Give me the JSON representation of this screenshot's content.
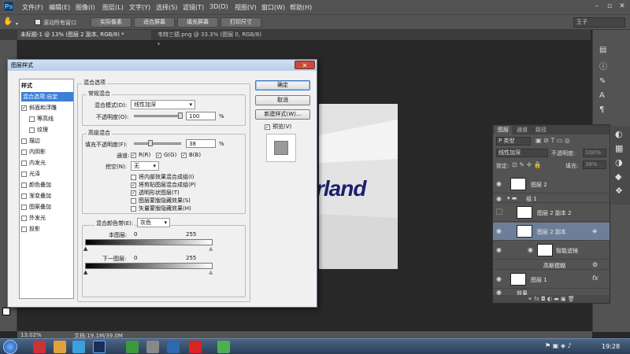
{
  "menubar": {
    "app_icon": "Ps",
    "items": [
      "文件(F)",
      "编辑(E)",
      "图像(I)",
      "图层(L)",
      "文字(Y)",
      "选择(S)",
      "滤镜(T)",
      "3D(D)",
      "视图(V)",
      "窗口(W)",
      "帮助(H)"
    ]
  },
  "optbar": {
    "checkbox_label": "滚动所有窗口",
    "buttons": [
      "实际像素",
      "适合屏幕",
      "填充屏幕",
      "打印尺寸"
    ],
    "workspace": "王子"
  },
  "tabs": [
    "未标题-1 @ 13% (图层 2 副本, RGB/8) *",
    "韦特三德.png @ 33.3% (图层 0, RGB/8) *"
  ],
  "canvas": {
    "text": "rland"
  },
  "dialog": {
    "title": "图层样式",
    "styles_header": "样式",
    "styles": [
      {
        "label": "混合选项:自定",
        "checked": null,
        "selected": true
      },
      {
        "label": "斜面和浮雕",
        "checked": true
      },
      {
        "label": "等高线",
        "checked": false,
        "indent": true
      },
      {
        "label": "纹理",
        "checked": false,
        "indent": true
      },
      {
        "label": "描边",
        "checked": false
      },
      {
        "label": "内阴影",
        "checked": false
      },
      {
        "label": "内发光",
        "checked": false
      },
      {
        "label": "光泽",
        "checked": false
      },
      {
        "label": "颜色叠加",
        "checked": false
      },
      {
        "label": "渐变叠加",
        "checked": false
      },
      {
        "label": "图案叠加",
        "checked": false
      },
      {
        "label": "外发光",
        "checked": false
      },
      {
        "label": "投影",
        "checked": false
      }
    ],
    "blend_options_title": "混合选项",
    "general_title": "常规混合",
    "blend_mode_label": "混合模式(D):",
    "blend_mode_value": "线性加深",
    "opacity_label": "不透明度(O):",
    "opacity_value": "100",
    "percent": "%",
    "advanced_title": "高级混合",
    "fill_opacity_label": "填充不透明度(F):",
    "fill_opacity_value": "38",
    "channels_label": "通道:",
    "channels": [
      "R(R)",
      "G(G)",
      "B(B)"
    ],
    "knockout_label": "挖空(N):",
    "knockout_value": "无",
    "adv_options": [
      {
        "label": "将内部效果混合成组(I)",
        "checked": false
      },
      {
        "label": "将剪贴图层混合成组(P)",
        "checked": true
      },
      {
        "label": "透明形状图层(T)",
        "checked": true
      },
      {
        "label": "图层蒙版隐藏效果(S)",
        "checked": false
      },
      {
        "label": "矢量蒙版隐藏效果(H)",
        "checked": false
      }
    ],
    "blend_if_label": "混合颜色带(E):",
    "blend_if_value": "灰色",
    "this_layer_label": "本图层:",
    "underlying_label": "下一图层:",
    "range_min": "0",
    "range_max": "255",
    "btn_ok": "确定",
    "btn_cancel": "取消",
    "btn_new_style": "新建样式(W)...",
    "preview_label": "预览(V)",
    "close": "✕"
  },
  "layers_panel": {
    "tabs": [
      "图层",
      "通道",
      "路径"
    ],
    "kind": "P 类型",
    "blend_mode": "线性加深",
    "opacity_label": "不透明度:",
    "opacity_value": "100%",
    "lock_label": "锁定:",
    "fill_label": "填充:",
    "fill_value": "38%",
    "layers": [
      {
        "name": "图层 2",
        "indent": 0,
        "eye": true
      },
      {
        "name": "组 1",
        "indent": 0,
        "eye": true,
        "group": true
      },
      {
        "name": "图层 2 副本 2",
        "indent": 1,
        "eye": false
      },
      {
        "name": "图层 2 副本",
        "indent": 1,
        "eye": true,
        "selected": true
      },
      {
        "name": "智能滤镜",
        "indent": 2,
        "eye": true
      },
      {
        "name": "高斯模糊",
        "indent": 2,
        "eye": false
      },
      {
        "name": "图层 1",
        "indent": 0,
        "eye": true
      },
      {
        "name": "效果",
        "indent": 1,
        "eye": true
      }
    ]
  },
  "status": {
    "zoom": "13.02%",
    "doc": "文档:19.1M/39.0M"
  },
  "taskbar": {
    "time": "19:28"
  }
}
